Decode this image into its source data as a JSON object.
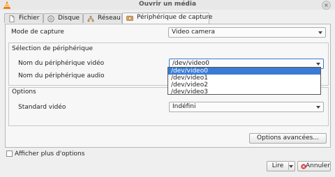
{
  "window": {
    "title": "Ouvrir un média",
    "close_glyph": "×",
    "app_icon": "vlc-cone-icon"
  },
  "tabs": [
    {
      "label": "Fichier",
      "icon": "file-icon"
    },
    {
      "label": "Disque",
      "icon": "disc-icon"
    },
    {
      "label": "Réseau",
      "icon": "network-icon"
    },
    {
      "label": "Périphérique de capture",
      "icon": "capture-device-icon"
    }
  ],
  "capture": {
    "mode_label": "Mode de capture",
    "mode_value": "Video camera",
    "device_section_title": "Sélection de périphérique",
    "video_device_label": "Nom du périphérique vidéo",
    "video_device_value": "/dev/video0",
    "video_device_options": [
      "/dev/video0",
      "/dev/video1",
      "/dev/video2",
      "/dev/video3"
    ],
    "audio_device_label": "Nom du périphérique audio",
    "options_section_title": "Options",
    "video_standard_label": "Standard vidéo",
    "video_standard_value": "Indéfini",
    "advanced_button": "Options avancées..."
  },
  "footer": {
    "more_options_label": "Afficher plus d'options",
    "play_button": "Lire",
    "cancel_button": "Annuler"
  }
}
